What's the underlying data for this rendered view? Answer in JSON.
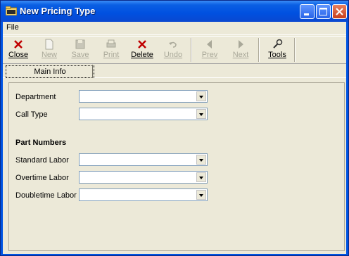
{
  "window": {
    "title": "New Pricing Type"
  },
  "menu": {
    "items": [
      "File"
    ]
  },
  "toolbar": {
    "close": "Close",
    "new": "New",
    "save": "Save",
    "print": "Print",
    "delete": "Delete",
    "undo": "Undo",
    "prev": "Prev",
    "next": "Next",
    "tools": "Tools"
  },
  "tabs": [
    "Main Info"
  ],
  "form": {
    "department_label": "Department",
    "call_type_label": "Call Type",
    "part_numbers_heading": "Part Numbers",
    "standard_labor_label": "Standard Labor",
    "overtime_labor_label": "Overtime Labor",
    "doubletime_labor_label": "Doubletime Labor",
    "department_value": "",
    "call_type_value": "",
    "standard_labor_value": "",
    "overtime_labor_value": "",
    "doubletime_labor_value": ""
  },
  "icons": {
    "app": "folder-icon",
    "minimize": "minimize-icon",
    "maximize": "maximize-icon",
    "close": "close-icon"
  }
}
